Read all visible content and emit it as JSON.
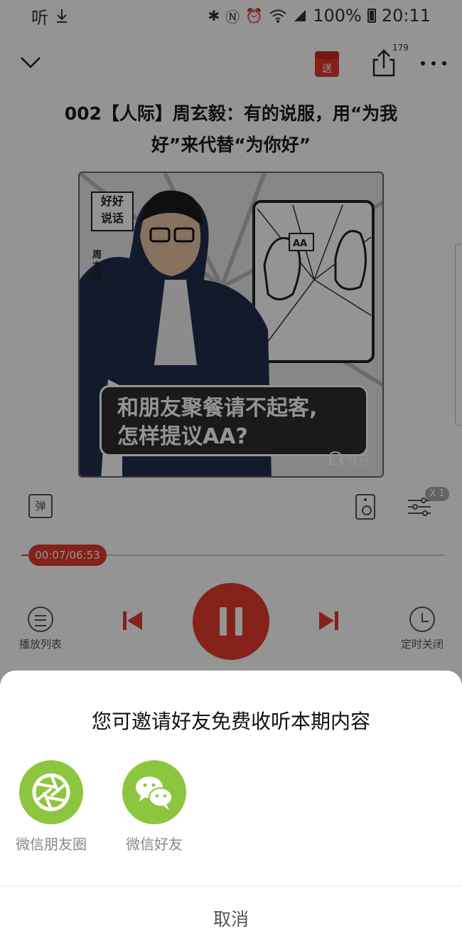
{
  "status_bar": {
    "left_text": "听",
    "battery": "100%",
    "time": "20:11"
  },
  "nav": {
    "gift_label": "送",
    "share_count": "179"
  },
  "episode": {
    "title_line1": "002【人际】周玄毅：有的说服，用“为我",
    "title_line2": "好”来代替“为你好”"
  },
  "cover": {
    "badge_line1": "好好",
    "badge_line2": "说话",
    "author": "周玄毅",
    "caption_line1": "和朋友聚餐请不起客,",
    "caption_line2": "怎样提议AA?",
    "play_count": "23.9万"
  },
  "player": {
    "danmu_label": "弹",
    "speed_label": "X 1",
    "progress": 0.018,
    "time_display": "00:07/06:53",
    "playlist_label": "播放列表",
    "timer_label": "定时关闭"
  },
  "sheet": {
    "title": "您可邀请好友免费收听本期内容",
    "targets": [
      {
        "label": "微信朋友圈",
        "icon": "wechat-moments-icon"
      },
      {
        "label": "微信好友",
        "icon": "wechat-icon"
      }
    ],
    "cancel": "取消"
  },
  "colors": {
    "accent": "#e33a2c",
    "share_green": "#8cc63f"
  }
}
